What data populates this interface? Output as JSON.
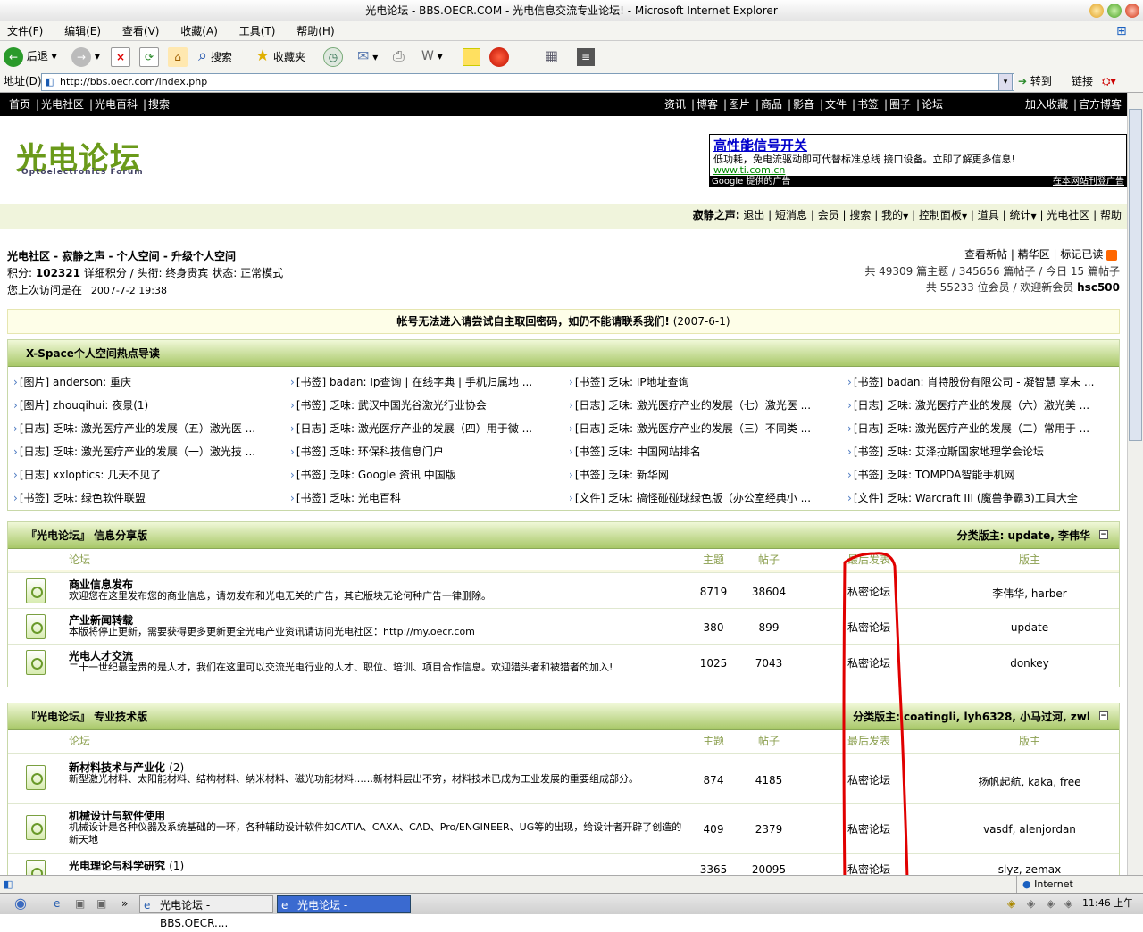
{
  "window": {
    "title": "光电论坛 - BBS.OECR.COM - 光电信息交流专业论坛! - Microsoft Internet Explorer"
  },
  "menu": [
    "文件(F)",
    "编辑(E)",
    "查看(V)",
    "收藏(A)",
    "工具(T)",
    "帮助(H)"
  ],
  "toolbar": {
    "back": "后退",
    "search": "搜索",
    "favorites": "收藏夹"
  },
  "address": {
    "label": "地址(D)",
    "url": "http://bbs.oecr.com/index.php",
    "go": "转到",
    "links": "链接"
  },
  "topnav": {
    "left": [
      "首页",
      "光电社区",
      "光电百科",
      "搜索"
    ],
    "middle": [
      "资讯",
      "博客",
      "图片",
      "商品",
      "影音",
      "文件",
      "书签",
      "圈子",
      "论坛"
    ],
    "right": [
      "加入收藏",
      "官方博客"
    ]
  },
  "logo": {
    "text": "光电论坛",
    "sub": "Optoelectronics Forum"
  },
  "ad": {
    "title": "高性能信号开关",
    "text": "低功耗，免电流驱动即可代替标准总线 接口设备。立即了解更多信息!",
    "url": "www.ti.com.cn",
    "left_foot": "Google 提供的广告",
    "right_foot": "在本网站刊登广告"
  },
  "userbar": {
    "user": "寂静之声:",
    "items": [
      "退出",
      "短消息",
      "会员",
      "搜索",
      "我的",
      "控制面板",
      "道具",
      "统计",
      "光电社区",
      "帮助"
    ]
  },
  "info": {
    "breadcrumb": "光电社区 - 寂静之声 - 个人空间 - 升级个人空间",
    "points_label": "积分:",
    "points": "102321",
    "detail": "详细积分",
    "rank_label": "头衔:",
    "rank": "终身贵宾",
    "status_label": "状态:",
    "status": "正常模式",
    "last_visit_label": "您上次访问是在",
    "last_visit": "2007-7-2 19:38",
    "right_links": [
      "查看新帖",
      "精华区",
      "标记已读"
    ],
    "stats1": "共 49309 篇主题 / 345656 篇帖子 / 今日 15 篇帖子",
    "stats2": "共 55233 位会员 / 欢迎新会员",
    "newest": "hsc500"
  },
  "notice": {
    "text": "帐号无法进入请尝试自主取回密码，如仍不能请联系我们!",
    "date": "(2007-6-1)"
  },
  "xspace": {
    "title": "X-Space个人空间热点导读",
    "rows": [
      [
        "[图片] anderson: 重庆",
        "[书签] badan: Ip查询 | 在线字典 | 手机归属地 ...",
        "[书签] 乏味: IP地址查询",
        "[书签] badan: 肖特股份有限公司 - 凝智慧 享未 ..."
      ],
      [
        "[图片] zhouqihui: 夜景(1)",
        "[书签] 乏味: 武汉中国光谷激光行业协会",
        "[日志] 乏味: 激光医疗产业的发展（七）激光医 ...",
        "[日志] 乏味: 激光医疗产业的发展（六）激光美 ..."
      ],
      [
        "[日志] 乏味: 激光医疗产业的发展（五）激光医 ...",
        "[日志] 乏味: 激光医疗产业的发展（四）用于微 ...",
        "[日志] 乏味: 激光医疗产业的发展（三）不同类 ...",
        "[日志] 乏味: 激光医疗产业的发展（二）常用于 ..."
      ],
      [
        "[日志] 乏味: 激光医疗产业的发展（一）激光技 ...",
        "[书签] 乏味: 环保科技信息门户",
        "[书签] 乏味: 中国网站排名",
        "[书签] 乏味: 艾泽拉斯国家地理学会论坛"
      ],
      [
        "[日志] xxloptics: 几天不见了",
        "[书签] 乏味: Google 资讯 中国版",
        "[书签] 乏味: 新华网",
        "[书签] 乏味: TOMPDA智能手机网"
      ],
      [
        "[书签] 乏味: 绿色软件联盟",
        "[书签] 乏味: 光电百科",
        "[文件] 乏味: 搞怪碰碰球绿色版（办公室经典小 ...",
        "[文件] 乏味: Warcraft III (魔兽争霸3)工具大全"
      ]
    ]
  },
  "cols": {
    "forum": "论坛",
    "topics": "主题",
    "posts": "帖子",
    "last": "最后发表",
    "mods": "版主"
  },
  "sec1": {
    "title": "『光电论坛』 信息分享版",
    "moderators": "分类版主: update, 李伟华",
    "forums": [
      {
        "name": "商业信息发布",
        "desc": "欢迎您在这里发布您的商业信息，请勿发布和光电无关的广告，其它版块无论何种广告一律删除。",
        "topics": "8719",
        "posts": "38604",
        "last": "私密论坛",
        "mods": "李伟华, harber"
      },
      {
        "name": "产业新闻转载",
        "desc": "本版将停止更新，需要获得更多更新更全光电产业资讯请访问光电社区：http://my.oecr.com",
        "topics": "380",
        "posts": "899",
        "last": "私密论坛",
        "mods": "update"
      },
      {
        "name": "光电人才交流",
        "desc": "二十一世纪最宝贵的是人才，我们在这里可以交流光电行业的人才、职位、培训、项目合作信息。欢迎猎头者和被猎者的加入!",
        "topics": "1025",
        "posts": "7043",
        "last": "私密论坛",
        "mods": "donkey"
      }
    ]
  },
  "sec2": {
    "title": "『光电论坛』 专业技术版",
    "moderators": "分类版主: coatingli, lyh6328, 小马过河, zwl",
    "forums": [
      {
        "name": "新材料技术与产业化",
        "count": "(2)",
        "desc": "新型激光材料、太阳能材料、结构材料、纳米材料、磁光功能材料……新材料层出不穷，材料技术已成为工业发展的重要组成部分。",
        "topics": "874",
        "posts": "4185",
        "last": "私密论坛",
        "mods": "扬帆起航, kaka, free"
      },
      {
        "name": "机械设计与软件使用",
        "count": "",
        "desc": "机械设计是各种仪器及系统基础的一环，各种辅助设计软件如CATIA、CAXA、CAD、Pro/ENGINEER、UG等的出现，给设计者开辟了创造的新天地",
        "topics": "409",
        "posts": "2379",
        "last": "私密论坛",
        "mods": "vasdf, alenjordan"
      },
      {
        "name": "光电理论与科学研究",
        "count": "(1)",
        "desc": "",
        "topics": "3365",
        "posts": "20095",
        "last": "私密论坛",
        "mods": "slyz, zemax"
      }
    ]
  },
  "status": {
    "zone": "Internet"
  },
  "taskbar": {
    "task1": "光电论坛 - BBS.OECR....",
    "task2": "光电论坛 - BBS.OECR....",
    "time": "11:46 上午"
  },
  "colors": {
    "accent_green": "#a8c868",
    "link_blue": "#0000cc",
    "annotation_red": "#e00000"
  }
}
